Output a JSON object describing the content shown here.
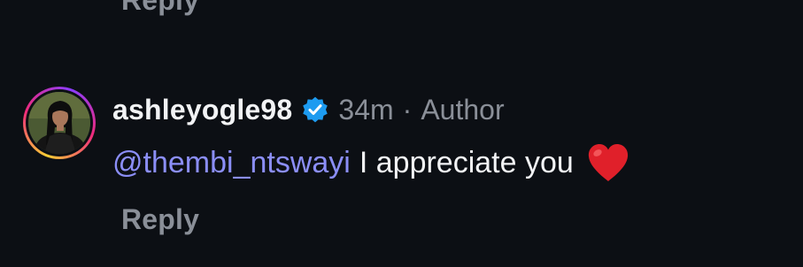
{
  "previous_comment": {
    "reply_label": "Reply"
  },
  "comment": {
    "username": "ashleyogle98",
    "verified_icon": "verified-badge-icon",
    "time": "34m",
    "separator": "·",
    "author_label": "Author",
    "mention": "@thembi_ntswayi",
    "text": "I appreciate you",
    "emoji_icon": "red-heart-icon",
    "reply_label": "Reply"
  },
  "colors": {
    "background": "#0c0f14",
    "mention": "#8b8ef7",
    "muted": "#8a8f98",
    "text": "#f2f3f5",
    "verified": "#1d9bf0",
    "heart": "#e0202a"
  }
}
